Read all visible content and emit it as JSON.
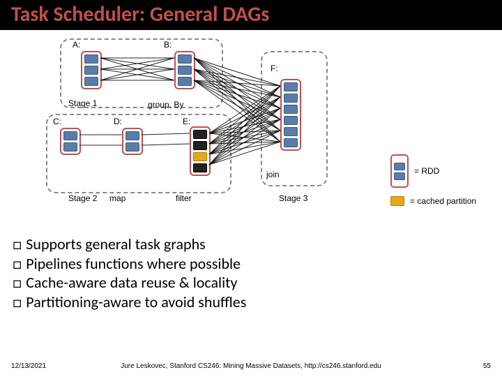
{
  "title": "Task Scheduler: General DAGs",
  "rdds": {
    "A": "A:",
    "B": "B:",
    "C": "C:",
    "D": "D:",
    "E": "E:",
    "F": "F:"
  },
  "stages": {
    "s1": "Stage 1",
    "s2": "Stage 2",
    "s3": "Stage 3"
  },
  "ops": {
    "groupBy": "group. By",
    "map": "map",
    "filter": "filter",
    "join": "join"
  },
  "legend": {
    "rdd": "= RDD",
    "cached": "= cached partition"
  },
  "bullets": {
    "b1": "Supports general task graphs",
    "b2": "Pipelines functions where possible",
    "b3": "Cache-aware data reuse & locality",
    "b4": "Partitioning-aware to avoid shuffles"
  },
  "footer": {
    "date": "12/13/2021",
    "center": "Jure Leskovec, Stanford CS246: Mining Massive Datasets, http://cs246.stanford.edu",
    "page": "55"
  }
}
